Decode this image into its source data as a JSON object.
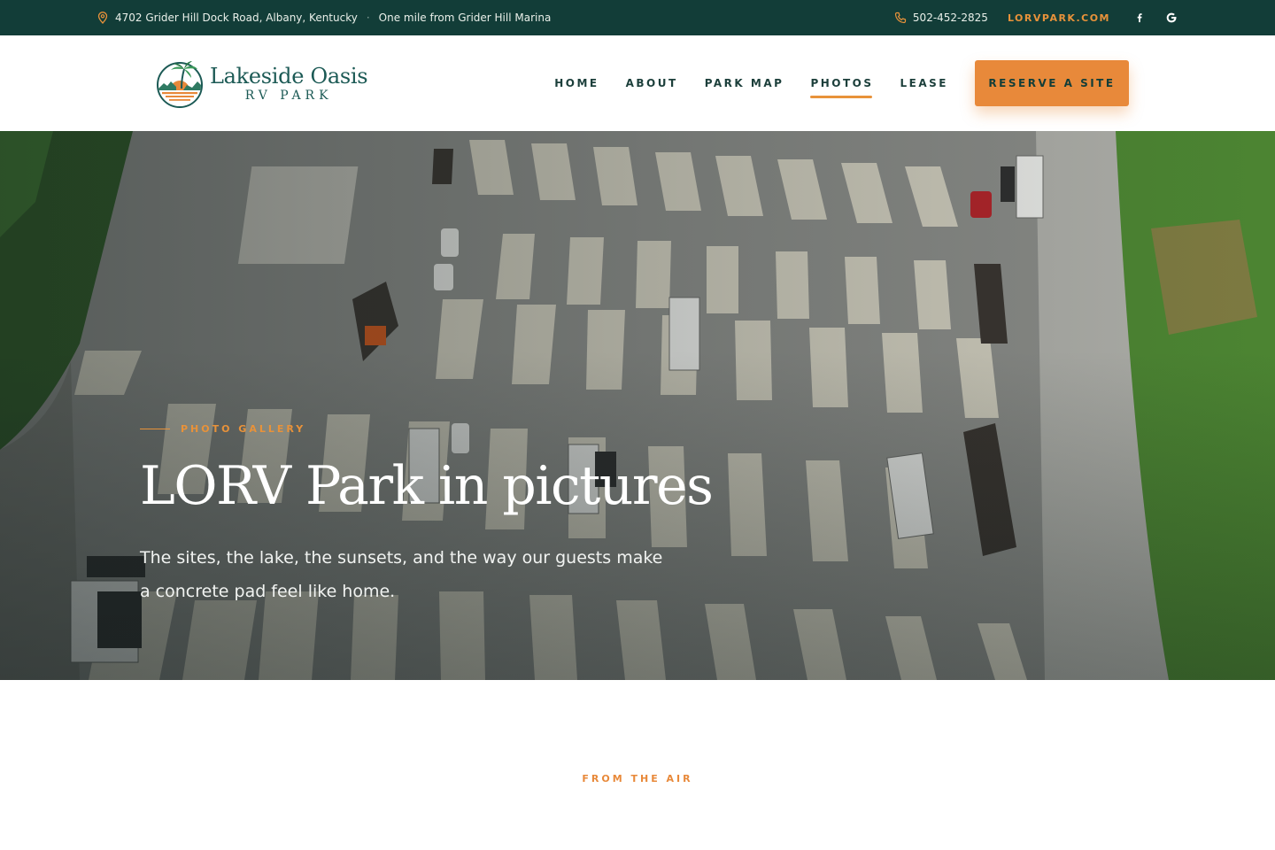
{
  "topbar": {
    "address": "4702 Grider Hill Dock Road, Albany, Kentucky",
    "separator": "·",
    "tagline": "One mile from Grider Hill Marina",
    "phone": "502-452-2825",
    "domain": "LORVPARK.COM"
  },
  "brand": {
    "name": "Lakeside Oasis",
    "sub": "RV PARK"
  },
  "nav": {
    "items": [
      {
        "label": "HOME"
      },
      {
        "label": "ABOUT"
      },
      {
        "label": "PARK MAP"
      },
      {
        "label": "PHOTOS"
      },
      {
        "label": "LEASE"
      }
    ],
    "active": "PHOTOS",
    "cta_label": "RESERVE A SITE"
  },
  "hero": {
    "eyebrow": "PHOTO GALLERY",
    "title": "LORV Park in pictures",
    "subtitle": "The sites, the lake, the sunsets, and the way our guests make a concrete pad feel like home."
  },
  "section": {
    "eyebrow": "FROM THE AIR"
  },
  "colors": {
    "topbar_bg": "#123d38",
    "accent": "#e8893a",
    "brand_teal": "#1c5a55"
  }
}
